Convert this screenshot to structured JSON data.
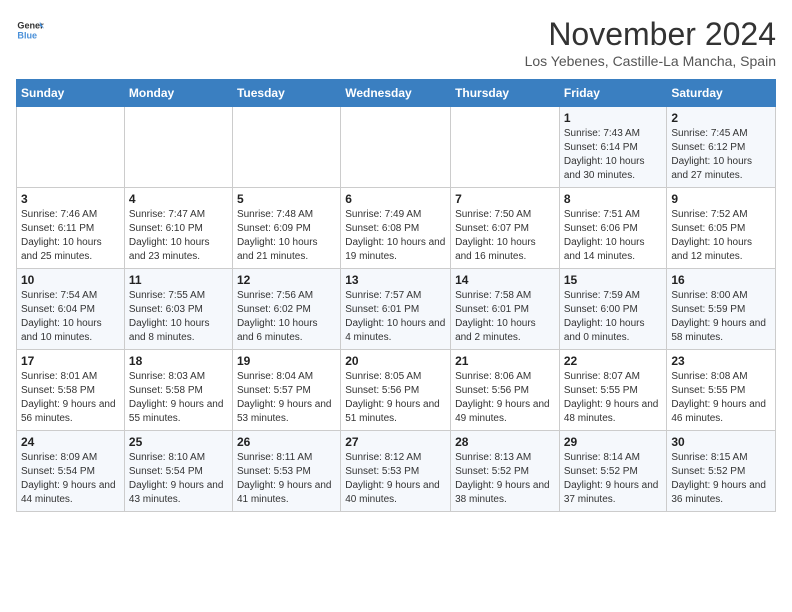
{
  "header": {
    "logo_line1": "General",
    "logo_line2": "Blue",
    "month": "November 2024",
    "location": "Los Yebenes, Castille-La Mancha, Spain"
  },
  "weekdays": [
    "Sunday",
    "Monday",
    "Tuesday",
    "Wednesday",
    "Thursday",
    "Friday",
    "Saturday"
  ],
  "weeks": [
    [
      {
        "day": "",
        "info": ""
      },
      {
        "day": "",
        "info": ""
      },
      {
        "day": "",
        "info": ""
      },
      {
        "day": "",
        "info": ""
      },
      {
        "day": "",
        "info": ""
      },
      {
        "day": "1",
        "info": "Sunrise: 7:43 AM\nSunset: 6:14 PM\nDaylight: 10 hours and 30 minutes."
      },
      {
        "day": "2",
        "info": "Sunrise: 7:45 AM\nSunset: 6:12 PM\nDaylight: 10 hours and 27 minutes."
      }
    ],
    [
      {
        "day": "3",
        "info": "Sunrise: 7:46 AM\nSunset: 6:11 PM\nDaylight: 10 hours and 25 minutes."
      },
      {
        "day": "4",
        "info": "Sunrise: 7:47 AM\nSunset: 6:10 PM\nDaylight: 10 hours and 23 minutes."
      },
      {
        "day": "5",
        "info": "Sunrise: 7:48 AM\nSunset: 6:09 PM\nDaylight: 10 hours and 21 minutes."
      },
      {
        "day": "6",
        "info": "Sunrise: 7:49 AM\nSunset: 6:08 PM\nDaylight: 10 hours and 19 minutes."
      },
      {
        "day": "7",
        "info": "Sunrise: 7:50 AM\nSunset: 6:07 PM\nDaylight: 10 hours and 16 minutes."
      },
      {
        "day": "8",
        "info": "Sunrise: 7:51 AM\nSunset: 6:06 PM\nDaylight: 10 hours and 14 minutes."
      },
      {
        "day": "9",
        "info": "Sunrise: 7:52 AM\nSunset: 6:05 PM\nDaylight: 10 hours and 12 minutes."
      }
    ],
    [
      {
        "day": "10",
        "info": "Sunrise: 7:54 AM\nSunset: 6:04 PM\nDaylight: 10 hours and 10 minutes."
      },
      {
        "day": "11",
        "info": "Sunrise: 7:55 AM\nSunset: 6:03 PM\nDaylight: 10 hours and 8 minutes."
      },
      {
        "day": "12",
        "info": "Sunrise: 7:56 AM\nSunset: 6:02 PM\nDaylight: 10 hours and 6 minutes."
      },
      {
        "day": "13",
        "info": "Sunrise: 7:57 AM\nSunset: 6:01 PM\nDaylight: 10 hours and 4 minutes."
      },
      {
        "day": "14",
        "info": "Sunrise: 7:58 AM\nSunset: 6:01 PM\nDaylight: 10 hours and 2 minutes."
      },
      {
        "day": "15",
        "info": "Sunrise: 7:59 AM\nSunset: 6:00 PM\nDaylight: 10 hours and 0 minutes."
      },
      {
        "day": "16",
        "info": "Sunrise: 8:00 AM\nSunset: 5:59 PM\nDaylight: 9 hours and 58 minutes."
      }
    ],
    [
      {
        "day": "17",
        "info": "Sunrise: 8:01 AM\nSunset: 5:58 PM\nDaylight: 9 hours and 56 minutes."
      },
      {
        "day": "18",
        "info": "Sunrise: 8:03 AM\nSunset: 5:58 PM\nDaylight: 9 hours and 55 minutes."
      },
      {
        "day": "19",
        "info": "Sunrise: 8:04 AM\nSunset: 5:57 PM\nDaylight: 9 hours and 53 minutes."
      },
      {
        "day": "20",
        "info": "Sunrise: 8:05 AM\nSunset: 5:56 PM\nDaylight: 9 hours and 51 minutes."
      },
      {
        "day": "21",
        "info": "Sunrise: 8:06 AM\nSunset: 5:56 PM\nDaylight: 9 hours and 49 minutes."
      },
      {
        "day": "22",
        "info": "Sunrise: 8:07 AM\nSunset: 5:55 PM\nDaylight: 9 hours and 48 minutes."
      },
      {
        "day": "23",
        "info": "Sunrise: 8:08 AM\nSunset: 5:55 PM\nDaylight: 9 hours and 46 minutes."
      }
    ],
    [
      {
        "day": "24",
        "info": "Sunrise: 8:09 AM\nSunset: 5:54 PM\nDaylight: 9 hours and 44 minutes."
      },
      {
        "day": "25",
        "info": "Sunrise: 8:10 AM\nSunset: 5:54 PM\nDaylight: 9 hours and 43 minutes."
      },
      {
        "day": "26",
        "info": "Sunrise: 8:11 AM\nSunset: 5:53 PM\nDaylight: 9 hours and 41 minutes."
      },
      {
        "day": "27",
        "info": "Sunrise: 8:12 AM\nSunset: 5:53 PM\nDaylight: 9 hours and 40 minutes."
      },
      {
        "day": "28",
        "info": "Sunrise: 8:13 AM\nSunset: 5:52 PM\nDaylight: 9 hours and 38 minutes."
      },
      {
        "day": "29",
        "info": "Sunrise: 8:14 AM\nSunset: 5:52 PM\nDaylight: 9 hours and 37 minutes."
      },
      {
        "day": "30",
        "info": "Sunrise: 8:15 AM\nSunset: 5:52 PM\nDaylight: 9 hours and 36 minutes."
      }
    ]
  ]
}
